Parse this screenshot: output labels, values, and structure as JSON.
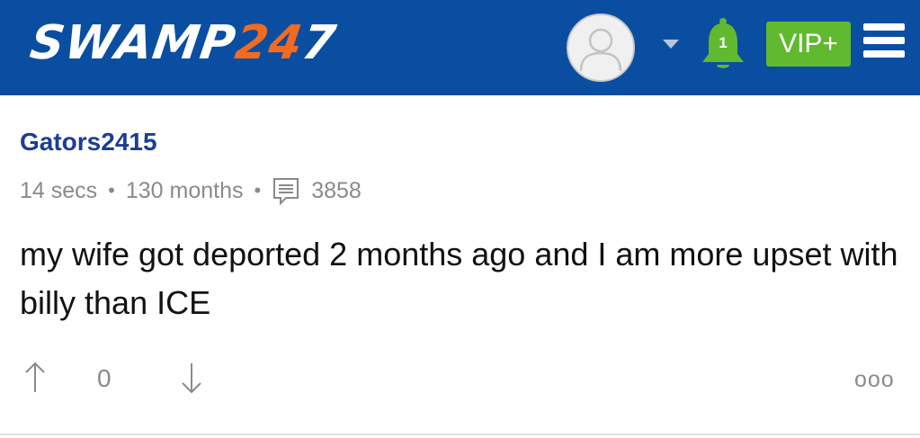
{
  "header": {
    "logo_part1": "SWAMP",
    "logo_part2": "24",
    "logo_part3": "7",
    "avatar_icon": "user-avatar-icon",
    "dropdown_icon": "caret-down-icon",
    "notification_count": "1",
    "vip_label": "VIP+",
    "menu_icon": "hamburger-menu-icon",
    "colors": {
      "bar": "#0a4ea2",
      "logo_accent": "#f26b21",
      "vip_green": "#61b92f",
      "bell_green": "#61b92f"
    }
  },
  "post": {
    "username": "Gators2415",
    "posted_ago": "14 secs",
    "member_for": "130 months",
    "separator": "•",
    "post_count": "3858",
    "text": "my wife got deported 2 months ago and I am more upset with billy than ICE",
    "score": "0",
    "more_label": "ooo"
  }
}
